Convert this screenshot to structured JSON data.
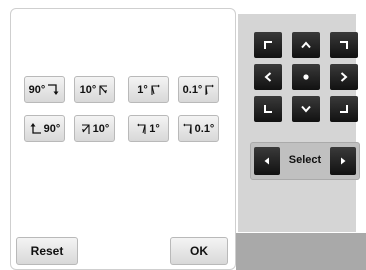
{
  "rotate": {
    "cw": [
      {
        "label": "90°",
        "icon": "rotate-cw-90-icon"
      },
      {
        "label": "10°",
        "icon": "rotate-cw-10-icon"
      },
      {
        "label": "1°",
        "icon": "rotate-cw-1-icon"
      },
      {
        "label": "0.1°",
        "icon": "rotate-cw-0.1-icon"
      }
    ],
    "ccw": [
      {
        "label": "90°",
        "icon": "rotate-ccw-90-icon"
      },
      {
        "label": "10°",
        "icon": "rotate-ccw-10-icon"
      },
      {
        "label": "1°",
        "icon": "rotate-ccw-1-icon"
      },
      {
        "label": "0.1°",
        "icon": "rotate-ccw-0.1-icon"
      }
    ]
  },
  "footer": {
    "reset_label": "Reset",
    "ok_label": "OK"
  },
  "direction_pad": {
    "icons": [
      "up-left-corner-icon",
      "up-arrow-icon",
      "up-right-corner-icon",
      "left-arrow-icon",
      "center-dot-icon",
      "right-arrow-icon",
      "down-left-corner-icon",
      "down-arrow-icon",
      "down-right-corner-icon"
    ]
  },
  "select": {
    "label": "Select"
  },
  "colors": {
    "panel_bg": "#ffffff",
    "side_bg": "#d5d5d5",
    "bottom_bar": "#a9a9a9",
    "dark_button": "#1e1e1e"
  }
}
